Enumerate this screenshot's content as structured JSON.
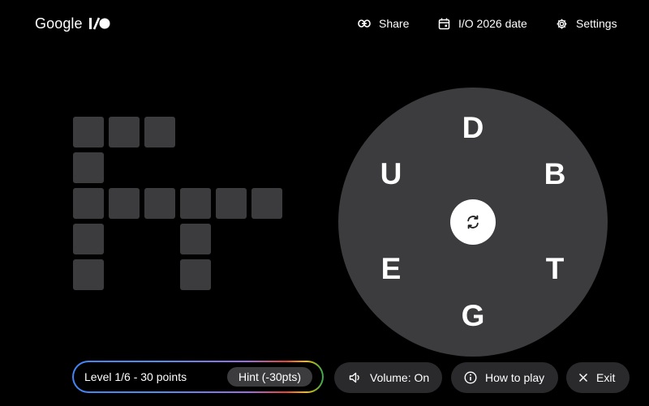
{
  "header": {
    "logo_text": "Google",
    "share_label": "Share",
    "date_label": "I/O 2026 date",
    "settings_label": "Settings",
    "icons": {
      "logo": "io-logo-icon",
      "share": "link-icon",
      "date": "calendar-icon",
      "settings": "gear-icon"
    }
  },
  "board": {
    "filled_cells": 0,
    "total_cells": 14
  },
  "wheel": {
    "letters": [
      "D",
      "B",
      "T",
      "G",
      "E",
      "U"
    ],
    "center_icon": "shuffle-icon"
  },
  "footer": {
    "level_label": "Level 1/6 - 30 points",
    "hint_label": "Hint (-30pts)",
    "volume_label": "Volume: On",
    "howto_label": "How to play",
    "exit_label": "Exit",
    "icons": {
      "volume": "volume-icon",
      "howto": "info-icon",
      "exit": "close-icon"
    }
  },
  "colors": {
    "background": "#000000",
    "tile": "#3c3c3f",
    "wheel": "#3c3c3f",
    "pill": "#2a2a2d",
    "text": "#ffffff"
  }
}
